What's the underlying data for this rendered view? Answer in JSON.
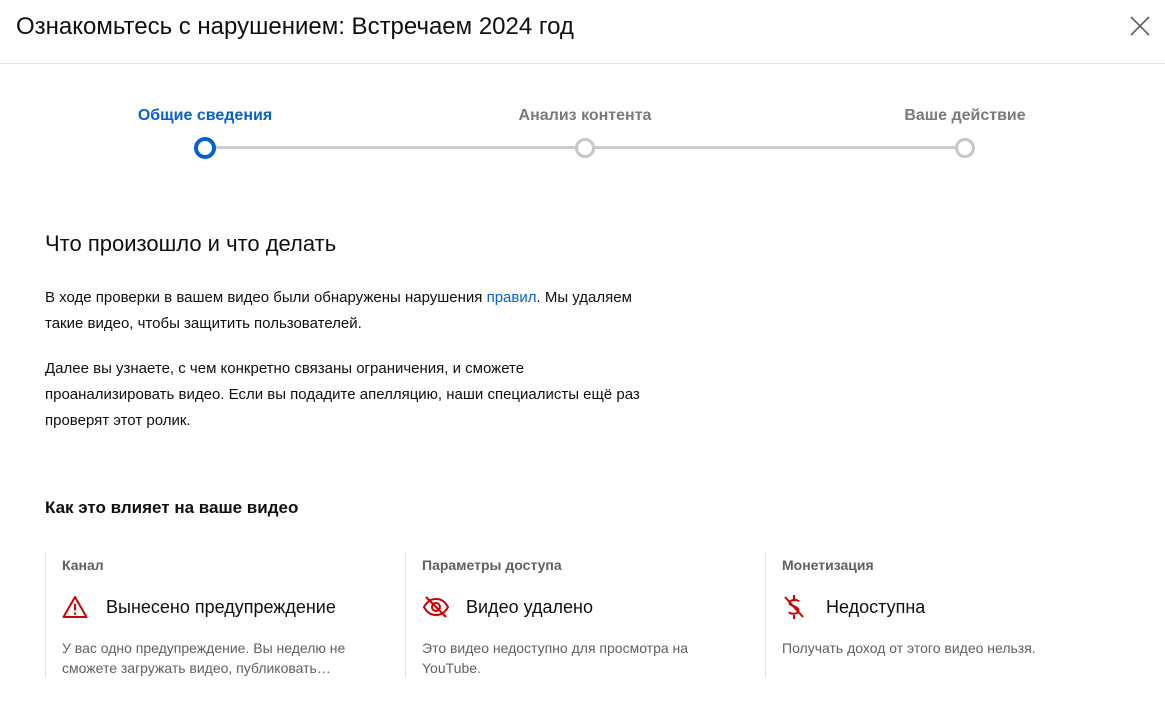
{
  "header": {
    "title": "Ознакомьтесь с нарушением: Встречаем 2024 год"
  },
  "stepper": {
    "steps": [
      {
        "label": "Общие сведения"
      },
      {
        "label": "Анализ контента"
      },
      {
        "label": "Ваше действие"
      }
    ],
    "active_step": 1
  },
  "main": {
    "title": "Что произошло и что делать",
    "para1_before": "В ходе проверки в вашем видео были обнаружены нарушения ",
    "para1_link": "правил",
    "para1_after": ". Мы удаляем такие видео, чтобы защитить пользователей.",
    "para2": "Далее вы узнаете, с чем конкретно связаны ограничения, и сможете проанализировать видео. Если вы подадите апелляцию, наши специалисты ещё раз проверят этот ролик."
  },
  "impact": {
    "title": "Как это влияет на ваше видео",
    "cards": [
      {
        "label": "Канал",
        "icon": "warning-icon",
        "status": "Вынесено предупреждение",
        "description": "У вас одно предупреждение. Вы неделю не сможете загружать видео, публиковать…"
      },
      {
        "label": "Параметры доступа",
        "icon": "eye-off-icon",
        "status": "Видео удалено",
        "description": "Это видео недоступно для просмотра на YouTube."
      },
      {
        "label": "Монетизация",
        "icon": "money-off-icon",
        "status": "Недоступна",
        "description": "Получать доход от этого видео нельзя."
      }
    ]
  },
  "colors": {
    "accent": "#065fd4",
    "alert": "#cc0000",
    "muted": "#606060"
  }
}
